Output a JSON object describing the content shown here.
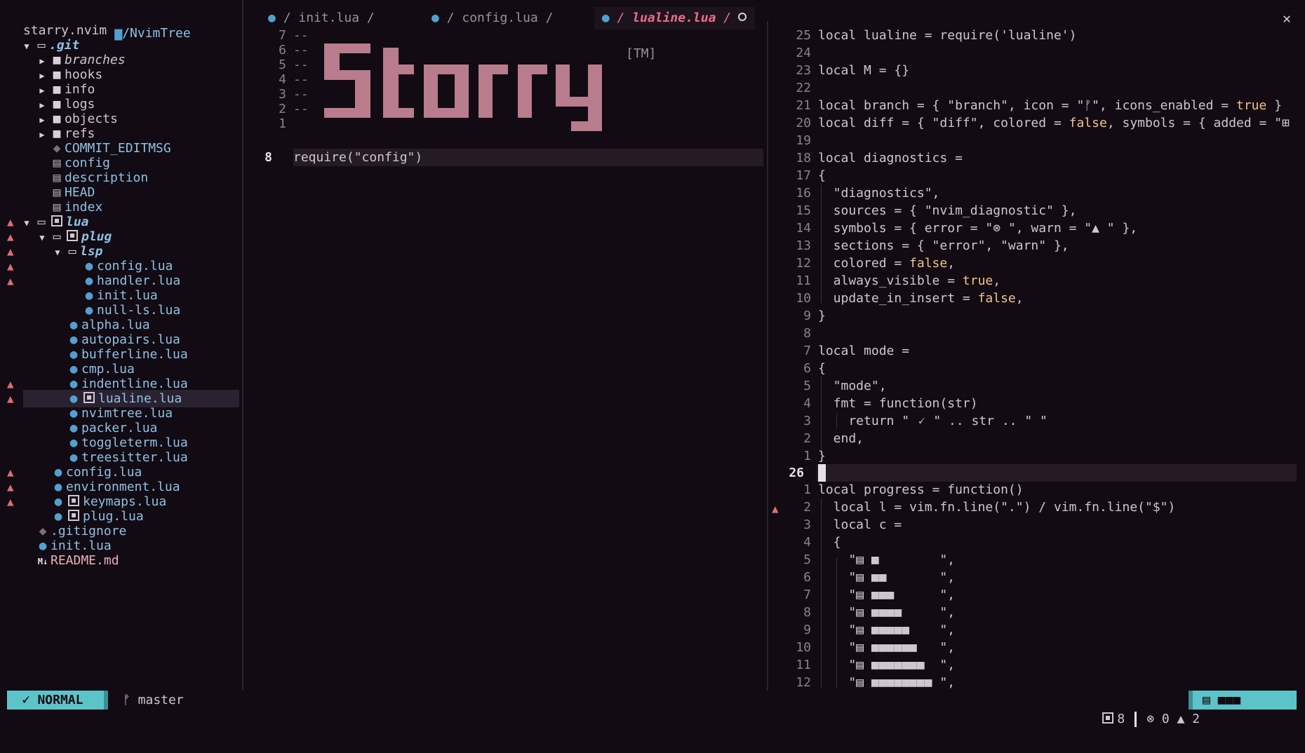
{
  "tree": {
    "header": "/NvimTree",
    "root": "starry.nvim",
    "items": [
      {
        "name": ".git"
      },
      {
        "name": "branches"
      },
      {
        "name": "hooks"
      },
      {
        "name": "info"
      },
      {
        "name": "logs"
      },
      {
        "name": "objects"
      },
      {
        "name": "refs"
      },
      {
        "name": "COMMIT_EDITMSG"
      },
      {
        "name": "config"
      },
      {
        "name": "description"
      },
      {
        "name": "HEAD"
      },
      {
        "name": "index"
      },
      {
        "name": "lua"
      },
      {
        "name": "plug"
      },
      {
        "name": "lsp"
      },
      {
        "name": "config.lua"
      },
      {
        "name": "handler.lua"
      },
      {
        "name": "init.lua"
      },
      {
        "name": "null-ls.lua"
      },
      {
        "name": "alpha.lua"
      },
      {
        "name": "autopairs.lua"
      },
      {
        "name": "bufferline.lua"
      },
      {
        "name": "cmp.lua"
      },
      {
        "name": "indentline.lua"
      },
      {
        "name": "lualine.lua"
      },
      {
        "name": "nvimtree.lua"
      },
      {
        "name": "packer.lua"
      },
      {
        "name": "toggleterm.lua"
      },
      {
        "name": "treesitter.lua"
      },
      {
        "name": "config.lua"
      },
      {
        "name": "environment.lua"
      },
      {
        "name": "keymaps.lua"
      },
      {
        "name": "plug.lua"
      },
      {
        "name": ".gitignore"
      },
      {
        "name": "init.lua"
      },
      {
        "name": "README.md"
      }
    ],
    "sign": "▲"
  },
  "tabs": [
    {
      "label": "init.lua",
      "sep": "/",
      "active": false
    },
    {
      "label": "config.lua",
      "sep": "/",
      "active": false
    },
    {
      "label": "lualine.lua",
      "sep": "/",
      "active": true
    }
  ],
  "close_all": "✕",
  "middle": {
    "line_numbers": [
      "7",
      "6",
      "5",
      "4",
      "3",
      "2",
      "1",
      "8"
    ],
    "comments": [
      "--",
      "--",
      "--",
      "--",
      "--",
      "--"
    ],
    "logo_text": "Starry",
    "tm": "[TM]",
    "code": "require(\"config\")"
  },
  "right": {
    "numbers_top": [
      "25",
      "24",
      "23",
      "22",
      "21",
      "20",
      "19",
      "18",
      "17",
      "16",
      "15",
      "14",
      "13",
      "12",
      "11",
      "10",
      "9",
      "8",
      "7",
      "6",
      "5",
      "4",
      "3",
      "2",
      "1"
    ],
    "current_line": "26",
    "numbers_bottom": [
      "1",
      "2",
      "3",
      "4",
      "5",
      "6",
      "7",
      "8",
      "9",
      "10",
      "11",
      "12"
    ],
    "lines_top": [
      "local lualine = require('lualine')",
      "",
      "local M = {}",
      "",
      "local branch = { \"branch\", icon = \"ᚠ\", icons_enabled = true }",
      "local diff = { \"diff\", colored = false, symbols = { added = \"⊞",
      "",
      "local diagnostics =",
      "{",
      "  \"diagnostics\",",
      "  sources = { \"nvim_diagnostic\" },",
      "  symbols = { error = \"⊗ \", warn = \"▲ \" },",
      "  sections = { \"error\", \"warn\" },",
      "  colored = false,",
      "  always_visible = true,",
      "  update_in_insert = false,",
      "}",
      "",
      "local mode =",
      "{",
      "  \"mode\",",
      "  fmt = function(str)",
      "    return \" 🗸 \" .. str .. \" \"",
      "  end,",
      "}"
    ],
    "lines_bottom": [
      "local progress = function()",
      "  local l = vim.fn.line(\".\") / vim.fn.line(\"$\")",
      "  local c =",
      "  {",
      "    \"▤ ■        \",",
      "    \"▤ ■■       \",",
      "    \"▤ ■■■      \",",
      "    \"▤ ■■■■     \",",
      "    \"▤ ■■■■■    \",",
      "    \"▤ ■■■■■■   \",",
      "    \"▤ ■■■■■■■  \",",
      "    \"▤ ■■■■■■■■ \","
    ]
  },
  "status": {
    "mode": "NORMAL",
    "mode_icon": "🗸",
    "branch_icon": "ᚠ",
    "branch": "master",
    "buffers": "8",
    "errors": "0",
    "warnings": "2",
    "progress": "▤ ■■■"
  },
  "colors": {
    "background": "#120b13",
    "accent": "#5cc4c9",
    "error": "#e06c75",
    "active_tab": "#ee6d85",
    "logo": "#b87c8c",
    "lua_icon": "#51a0cf"
  }
}
